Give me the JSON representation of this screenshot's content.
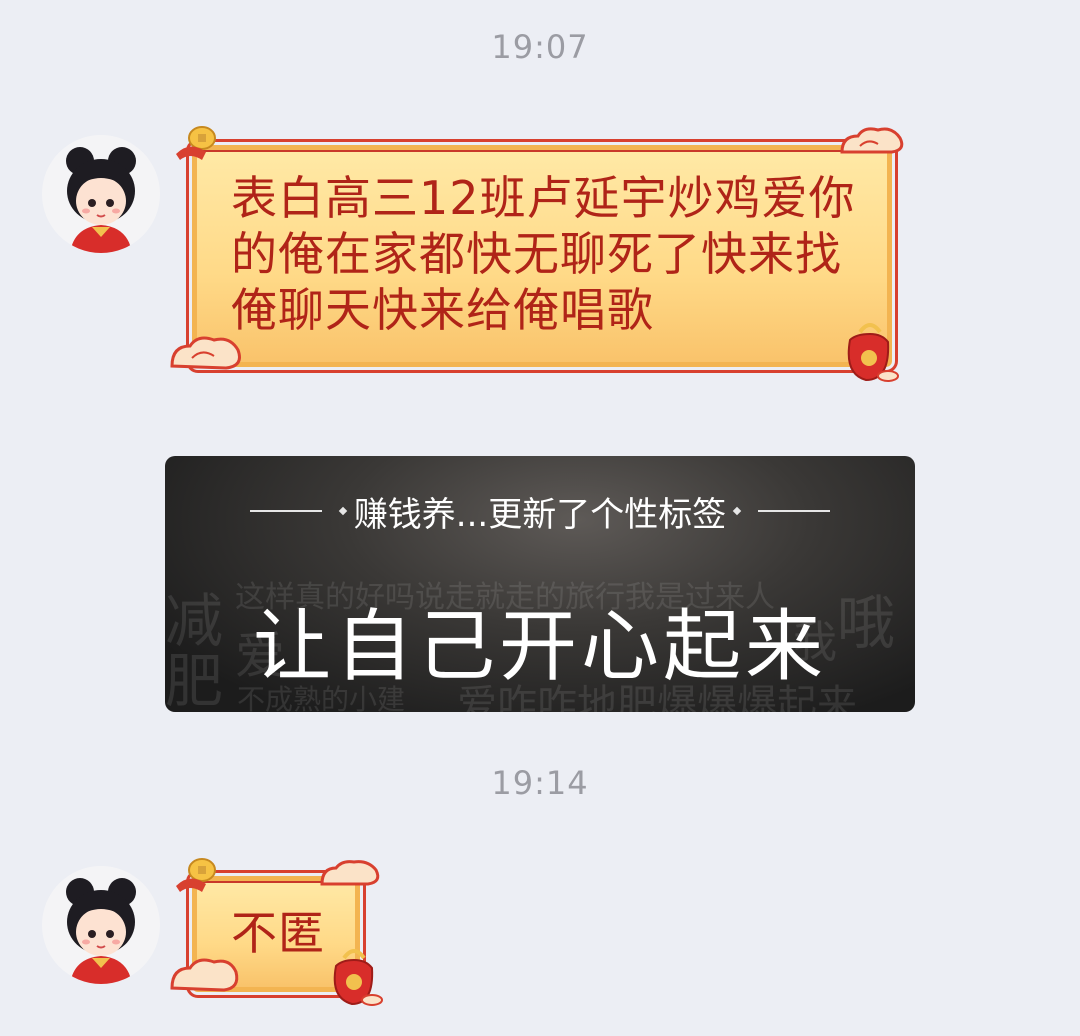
{
  "timestamps": [
    "19:07",
    "19:14"
  ],
  "messages": [
    {
      "type": "festive-bubble",
      "text": "表白高三12班卢延宇炒鸡爱你的俺在家都快无聊死了快来找俺聊天快来给俺唱歌"
    },
    {
      "type": "signature-card",
      "header": "赚钱养...更新了个性标签",
      "main": "让自己开心起来",
      "background_words": [
        "减",
        "肥",
        "这样真的好吗说走就走的旅行我是过来人",
        "爱",
        "不成熟的小建",
        "爱咋咋地肥爆爆爆起来",
        "哦",
        "我"
      ]
    },
    {
      "type": "festive-bubble",
      "text": "不匿"
    }
  ],
  "colors": {
    "background": "#eceef4",
    "bubble_fill": "#ffd987",
    "bubble_border": "#d8402f",
    "bubble_text": "#b02418",
    "card_bg": "#2a2928",
    "timestamp": "#9b9ca3"
  }
}
